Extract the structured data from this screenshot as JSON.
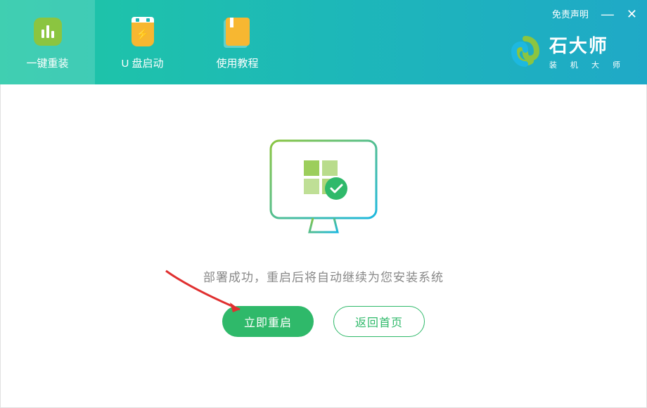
{
  "header": {
    "tabs": [
      {
        "label": "一键重装",
        "icon": "reinstall-icon"
      },
      {
        "label": "U 盘启动",
        "icon": "usb-icon"
      },
      {
        "label": "使用教程",
        "icon": "tutorial-icon"
      }
    ],
    "disclaimer": "免责声明"
  },
  "brand": {
    "title": "石大师",
    "subtitle": "装 机 大 师"
  },
  "main": {
    "status_message": "部署成功，重启后将自动继续为您安装系统",
    "primary_button": "立即重启",
    "secondary_button": "返回首页"
  },
  "colors": {
    "header_gradient_start": "#1fc7a4",
    "header_gradient_end": "#1fa9c7",
    "primary_green": "#2fb96a",
    "accent_green": "#8bc540",
    "accent_yellow": "#f7b731"
  }
}
